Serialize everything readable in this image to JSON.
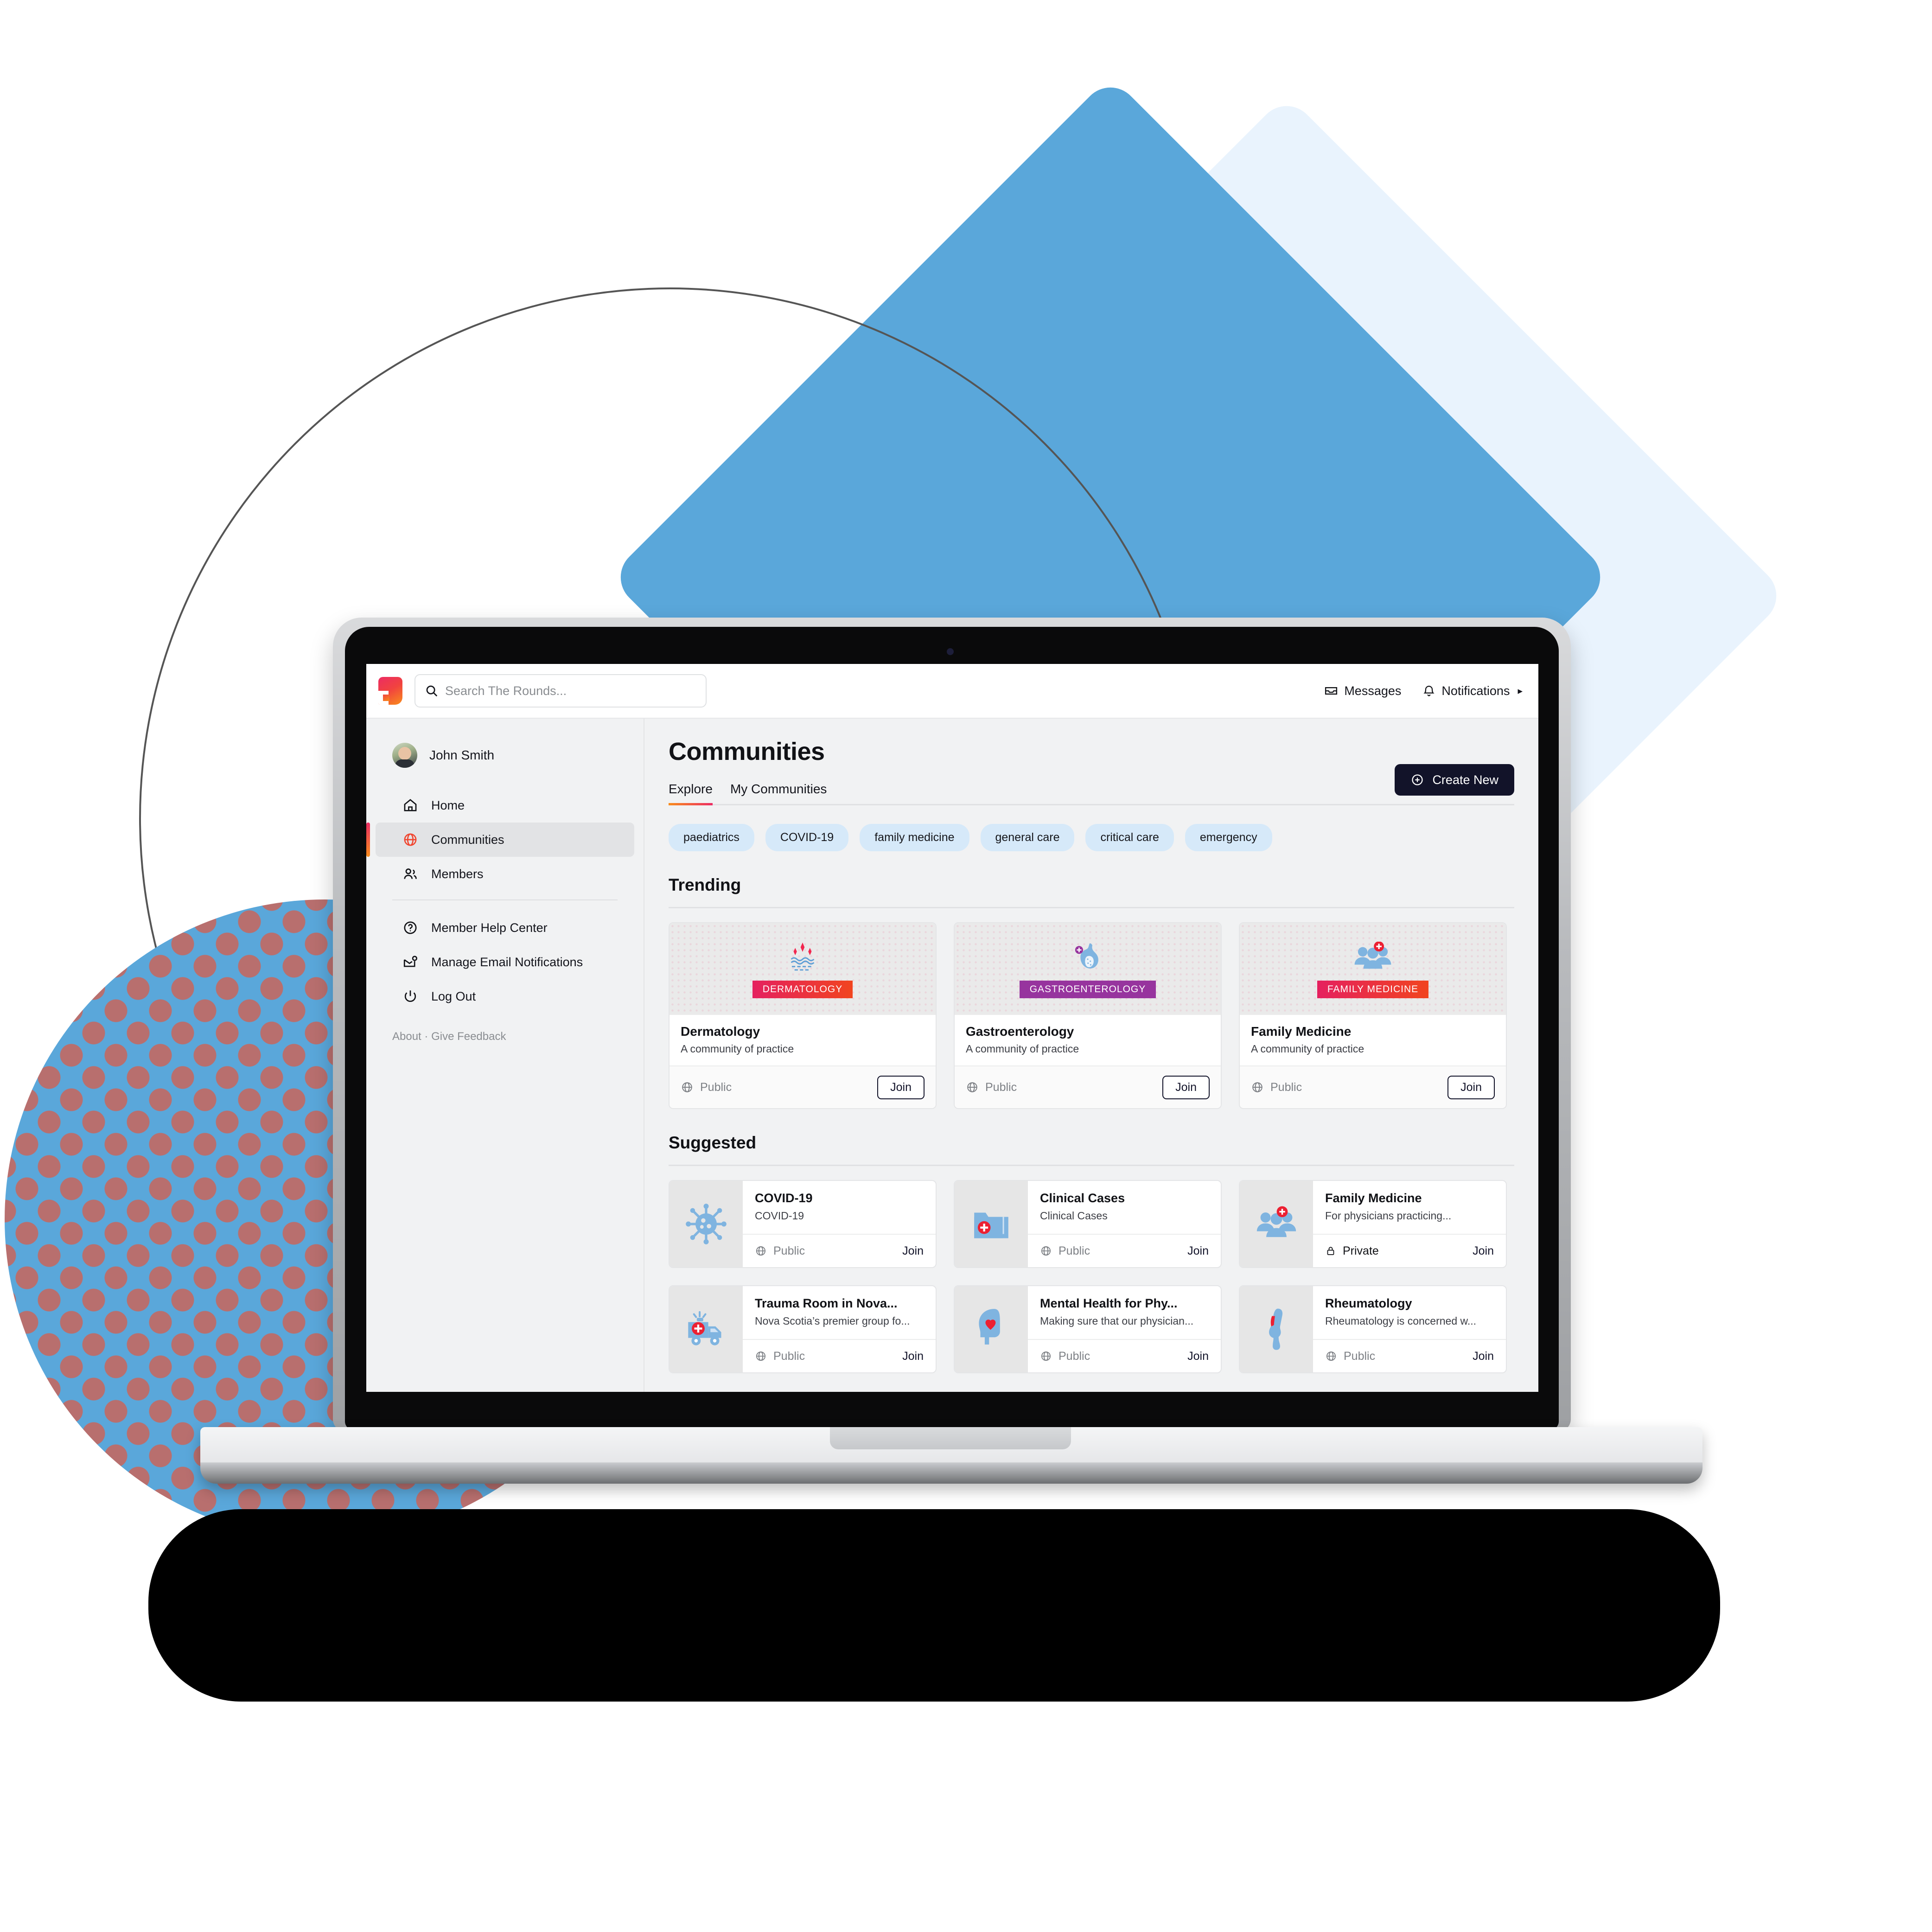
{
  "app": {
    "brand_icon": "the-rounds-logo"
  },
  "topbar": {
    "search_placeholder": "Search The Rounds...",
    "search_value": "",
    "search_icon": "search-icon",
    "messages_label": "Messages",
    "messages_icon": "inbox-icon",
    "notifications_label": "Notifications",
    "notifications_icon": "bell-icon",
    "caret": "▸"
  },
  "sidebar": {
    "user": {
      "name": "John Smith",
      "avatar": "user-avatar"
    },
    "items": [
      {
        "label": "Home",
        "icon": "home-icon",
        "active": false
      },
      {
        "label": "Communities",
        "icon": "globe-icon",
        "active": true
      },
      {
        "label": "Members",
        "icon": "people-icon",
        "active": false
      },
      {
        "label": "Member Help Center",
        "icon": "question-circle-icon",
        "active": false
      },
      {
        "label": "Manage Email Notifications",
        "icon": "mail-alert-icon",
        "active": false
      },
      {
        "label": "Log Out",
        "icon": "power-icon",
        "active": false
      }
    ],
    "footer": {
      "about": "About",
      "separator": "·",
      "feedback": "Give Feedback"
    }
  },
  "main": {
    "title": "Communities",
    "tabs": [
      {
        "label": "Explore",
        "active": true
      },
      {
        "label": "My Communities",
        "active": false
      }
    ],
    "create_button": {
      "label": "Create New",
      "icon": "plus-circle-icon"
    },
    "chips": [
      "paediatrics",
      "COVID-19",
      "family medicine",
      "general care",
      "critical care",
      "emergency"
    ],
    "trending": {
      "heading": "Trending",
      "cards": [
        {
          "title": "Dermatology",
          "subtitle": "A community of practice",
          "cover_tag": "DERMATOLOGY",
          "cover_tag_color": "#e5205f",
          "cover_art": "skin-sparkle-icon",
          "visibility": "Public",
          "visibility_icon": "globe-icon",
          "action": "Join"
        },
        {
          "title": "Gastroenterology",
          "subtitle": "A community of practice",
          "cover_tag": "GASTROENTEROLOGY",
          "cover_tag_color": "#97349e",
          "cover_art": "stomach-icon",
          "visibility": "Public",
          "visibility_icon": "globe-icon",
          "action": "Join"
        },
        {
          "title": "Family Medicine",
          "subtitle": "A community of practice",
          "cover_tag": "FAMILY MEDICINE",
          "cover_tag_color": "#e5205f",
          "cover_art": "group-plus-icon",
          "visibility": "Public",
          "visibility_icon": "globe-icon",
          "action": "Join"
        }
      ]
    },
    "suggested": {
      "heading": "Suggested",
      "cards": [
        {
          "title": "COVID-19",
          "subtitle": "COVID-19",
          "icon": "virus-icon",
          "visibility": "Public",
          "visibility_icon": "globe-icon",
          "action": "Join"
        },
        {
          "title": "Clinical Cases",
          "subtitle": "Clinical Cases",
          "icon": "folder-medical-icon",
          "visibility": "Public",
          "visibility_icon": "globe-icon",
          "action": "Join"
        },
        {
          "title": "Family Medicine",
          "subtitle": "For physicians practicing...",
          "icon": "group-plus-icon",
          "visibility": "Private",
          "visibility_icon": "lock-icon",
          "action": "Join"
        },
        {
          "title": "Trauma Room in Nova...",
          "subtitle": "Nova Scotia’s premier group fo...",
          "icon": "ambulance-icon",
          "visibility": "Public",
          "visibility_icon": "globe-icon",
          "action": "Join"
        },
        {
          "title": "Mental Health for Phy...",
          "subtitle": "Making sure that our physician...",
          "icon": "head-heart-icon",
          "visibility": "Public",
          "visibility_icon": "globe-icon",
          "action": "Join"
        },
        {
          "title": "Rheumatology",
          "subtitle": "Rheumatology is concerned w...",
          "icon": "knee-joint-icon",
          "visibility": "Public",
          "visibility_icon": "globe-icon",
          "action": "Join"
        }
      ]
    }
  },
  "colors": {
    "brand_gradient_start": "#f98d1c",
    "brand_gradient_end": "#ec2c63",
    "accent_dark": "#121329",
    "chip_bg": "#d6e9f9",
    "deco_blue": "#5aa7da",
    "deco_pale": "#e9f3fd"
  }
}
